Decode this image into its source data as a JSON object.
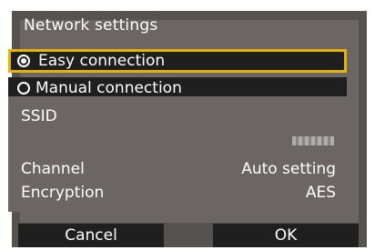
{
  "title": "Network settings",
  "options": [
    {
      "label": "Easy connection",
      "checked": true
    },
    {
      "label": "Manual connection",
      "checked": false
    }
  ],
  "fields": {
    "ssid_label": "SSID",
    "channel_label": "Channel",
    "channel_value": "Auto setting",
    "encryption_label": "Encryption",
    "encryption_value": "AES"
  },
  "buttons": {
    "cancel": "Cancel",
    "ok": "OK"
  },
  "colors": {
    "selection_border": "#e7b300",
    "background": "#55524f",
    "panel": "#6b6663",
    "button": "#1f1f1f"
  }
}
